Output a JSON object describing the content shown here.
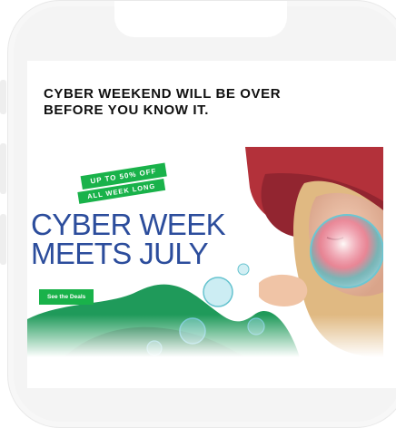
{
  "email": {
    "headline_line1": "CYBER WEEKEND WILL BE OVER",
    "headline_line2": "BEFORE YOU KNOW IT."
  },
  "hero": {
    "badge_top": "UP TO 50% OFF",
    "badge_bottom": "ALL WEEK LONG",
    "title_line1": "CYBER WEEK",
    "title_line2": "MEETS JULY",
    "cta_label": "See the Deals"
  },
  "colors": {
    "accent_green": "#19b24a",
    "title_blue": "#2c4d9c",
    "hat_red": "#b3313a"
  }
}
